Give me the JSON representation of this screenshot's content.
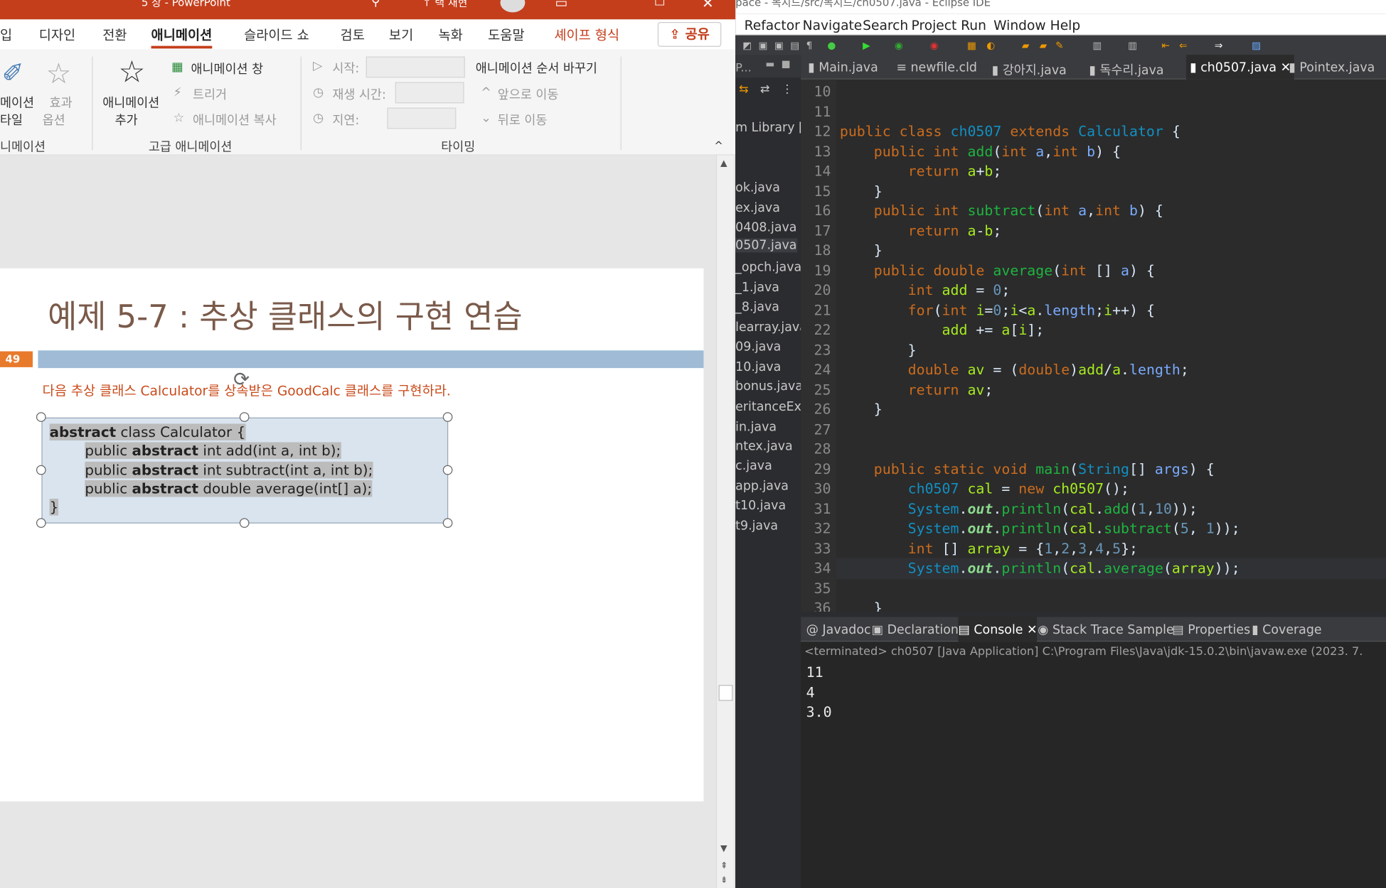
{
  "ppt": {
    "title": "5 장 - PowerPoint",
    "update": "↑ 택 재현",
    "menu": [
      "입",
      "디자인",
      "전환",
      "애니메이션",
      "슬라이드 쇼",
      "검토",
      "보기",
      "녹화",
      "도움말",
      "셰이프 형식"
    ],
    "share": "공유",
    "ribbon": {
      "anim_style_1": "메이션",
      "anim_style_2": "타일",
      "effect_opts_1": "효과",
      "effect_opts_2": "옵션",
      "add_anim_1": "애니메이션",
      "add_anim_2": "추가",
      "anim_pane": "애니메이션 창",
      "trigger": "트리거",
      "anim_copy": "애니메이션 복사",
      "start": "시작:",
      "duration": "재생 시간:",
      "delay": "지연:",
      "reorder": "애니메이션 순서 바꾸기",
      "move_fwd": "앞으로 이동",
      "move_back": "뒤로 이동",
      "grp_anim": "니메이션",
      "grp_adv": "고급 애니메이션",
      "grp_timing": "타이밍"
    },
    "slide": {
      "title": "예제 5-7 : 추상 클래스의 구현 연습",
      "number": "49",
      "desc": "다음 추상 클래스 Calculator를 상속받은 GoodCalc 클래스를 구현하라.",
      "code": [
        {
          "b": "abstract",
          "r": " class Calculator {"
        },
        {
          "a": "public ",
          "b": "abstract",
          "r": " int add(int a, int b);"
        },
        {
          "a": "public ",
          "b": "abstract",
          "r": " int subtract(int a, int b);"
        },
        {
          "a": "public ",
          "b": "abstract",
          "r": " double average(int[] a);"
        },
        {
          "r": "}"
        }
      ]
    }
  },
  "eclipse": {
    "title": "pace - 목지드/src/목지드/ch0507.java - Eclipse IDE",
    "menu": [
      "Refactor",
      "Navigate",
      "Search",
      "Project",
      "Run",
      "Window",
      "Help"
    ],
    "pkg_header": "P...",
    "pkg_items": [
      "m Library [",
      "ok.java",
      "ex.java",
      "0408.java",
      "0507.java",
      "_opch.java",
      "_1.java",
      "_8.java",
      "learray.java",
      "09.java",
      "10.java",
      "bonus.java",
      "eritanceEx.j",
      "in.java",
      "ntex.java",
      "c.java",
      "app.java",
      "t10.java",
      "t9.java"
    ],
    "tabs": [
      "Main.java",
      "newfile.cld",
      "강아지.java",
      "독수리.java",
      "ch0507.java",
      "Pointex.java"
    ],
    "line_numbers": [
      "10",
      "11",
      "12",
      "13",
      "14",
      "15",
      "16",
      "17",
      "18",
      "19",
      "20",
      "21",
      "22",
      "23",
      "24",
      "25",
      "26",
      "27",
      "28",
      "29",
      "30",
      "31",
      "32",
      "33",
      "34",
      "35",
      "36"
    ],
    "console_tabs": [
      "Javadoc",
      "Declaration",
      "Console",
      "Stack Trace Sample",
      "Properties",
      "Coverage"
    ],
    "console_header": "<terminated> ch0507 [Java Application] C:\\Program Files\\Java\\jdk-15.0.2\\bin\\javaw.exe (2023. 7.",
    "output": [
      "11",
      "4",
      "3.0"
    ]
  }
}
